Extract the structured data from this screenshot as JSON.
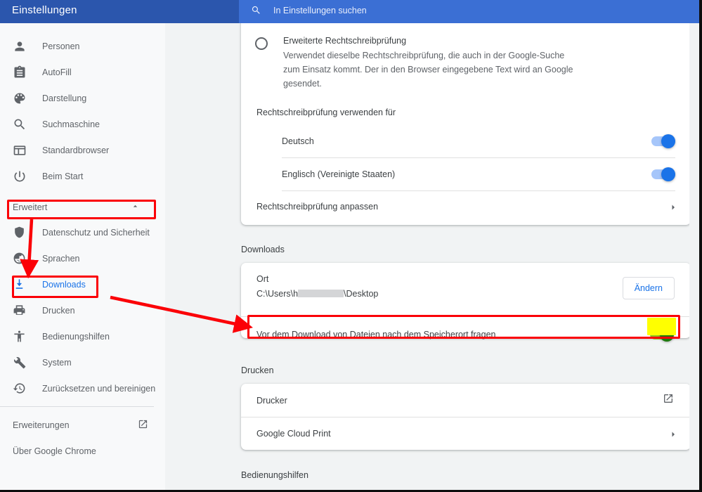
{
  "window": {
    "title": "Einstellungen",
    "accent_blue": "#3b6fd4",
    "sidebar_bg": "#f8f9fa",
    "content_bg": "#f1f3f4",
    "link_blue": "#1a73e8",
    "annotation_red": "#fb0007",
    "highlight_yellow": "#ffff00",
    "toggle_green": "#1c7a0e"
  },
  "search": {
    "placeholder": "In Einstellungen suchen",
    "icon": "search-icon"
  },
  "sidebar": {
    "items": [
      {
        "label": "Personen",
        "icon": "person-icon"
      },
      {
        "label": "AutoFill",
        "icon": "clipboard-icon"
      },
      {
        "label": "Darstellung",
        "icon": "palette-icon"
      },
      {
        "label": "Suchmaschine",
        "icon": "search-icon"
      },
      {
        "label": "Standardbrowser",
        "icon": "browser-window-icon"
      },
      {
        "label": "Beim Start",
        "icon": "power-icon"
      }
    ],
    "advanced": {
      "label": "Erweitert",
      "icon": "chevron-up-icon",
      "expanded": true
    },
    "advanced_items": [
      {
        "label": "Datenschutz und Sicherheit",
        "icon": "shield-icon",
        "active": false
      },
      {
        "label": "Sprachen",
        "icon": "globe-icon",
        "active": false
      },
      {
        "label": "Downloads",
        "icon": "download-icon",
        "active": true
      },
      {
        "label": "Drucken",
        "icon": "printer-icon",
        "active": false
      },
      {
        "label": "Bedienungshilfen",
        "icon": "accessibility-icon",
        "active": false
      },
      {
        "label": "System",
        "icon": "wrench-icon",
        "active": false
      },
      {
        "label": "Zurücksetzen und bereinigen",
        "icon": "history-restore-icon",
        "active": false
      }
    ],
    "footer_items": [
      {
        "label": "Erweiterungen",
        "icon": "external-link-icon"
      },
      {
        "label": "Über Google Chrome",
        "icon": null
      }
    ]
  },
  "content": {
    "spellcheck_option": {
      "title": "Erweiterte Rechtschreibprüfung",
      "description": "Verwendet dieselbe Rechtschreibprüfung, die auch in der Google-Suche zum Einsatz kommt. Der in den Browser eingegebene Text wird an Google gesendet.",
      "selected": false
    },
    "spellcheck_languages_header": "Rechtschreibprüfung verwenden für",
    "languages": [
      {
        "label": "Deutsch",
        "enabled": true
      },
      {
        "label": "Englisch (Vereinigte Staaten)",
        "enabled": true
      }
    ],
    "customize_row": {
      "label": "Rechtschreibprüfung anpassen",
      "icon": "chevron-right-icon"
    },
    "downloads": {
      "section_title": "Downloads",
      "location_label": "Ort",
      "location_path_prefix": "C:\\Users\\h",
      "location_path_suffix": "\\Desktop",
      "change_button": "Ändern",
      "ask_row": {
        "label": "Vor dem Download von Dateien nach dem Speicherort fragen",
        "enabled": true
      }
    },
    "printing": {
      "section_title": "Drucken",
      "rows": [
        {
          "label": "Drucker",
          "icon": "external-link-icon"
        },
        {
          "label": "Google Cloud Print",
          "icon": "chevron-right-icon"
        }
      ]
    },
    "accessibility_section_title": "Bedienungshilfen"
  },
  "annotations": {
    "boxes": [
      {
        "name": "erweitert-highlight"
      },
      {
        "name": "downloads-highlight"
      },
      {
        "name": "ask-location-row-highlight"
      }
    ],
    "arrows": [
      {
        "name": "erweitert-to-downloads-arrow"
      },
      {
        "name": "downloads-to-ask-row-arrow"
      }
    ]
  }
}
